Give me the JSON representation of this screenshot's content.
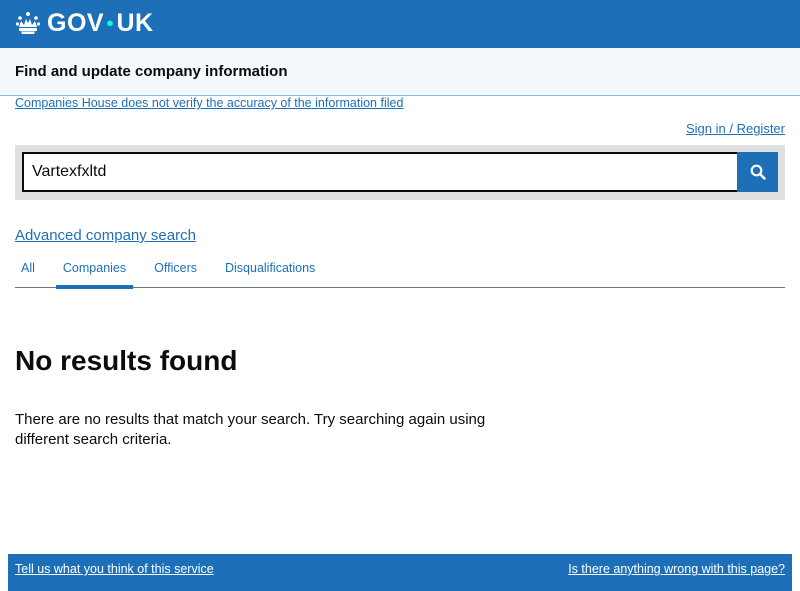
{
  "header": {
    "logo_text_left": "GOV",
    "logo_text_right": "UK",
    "logo_icon": "crown-icon"
  },
  "service": {
    "name": "Find and update company information"
  },
  "links": {
    "disclaimer": "Companies House does not verify the accuracy of the information filed",
    "signin": "Sign in / Register",
    "advanced_search": "Advanced company search"
  },
  "search": {
    "value": "Vartexfxltd",
    "button_icon": "search-icon"
  },
  "tabs": [
    {
      "label": "All",
      "active": false
    },
    {
      "label": "Companies",
      "active": true
    },
    {
      "label": "Officers",
      "active": false
    },
    {
      "label": "Disqualifications",
      "active": false
    }
  ],
  "results": {
    "title": "No results found",
    "message": "There are no results that match your search. Try searching again using different search criteria."
  },
  "footer": {
    "feedback": "Tell us what you think of this service",
    "report": "Is there anything wrong with this page?"
  },
  "colors": {
    "brand_blue": "#1d70b8",
    "text": "#0b0c0c",
    "service_bar": "#f3f8fd"
  }
}
